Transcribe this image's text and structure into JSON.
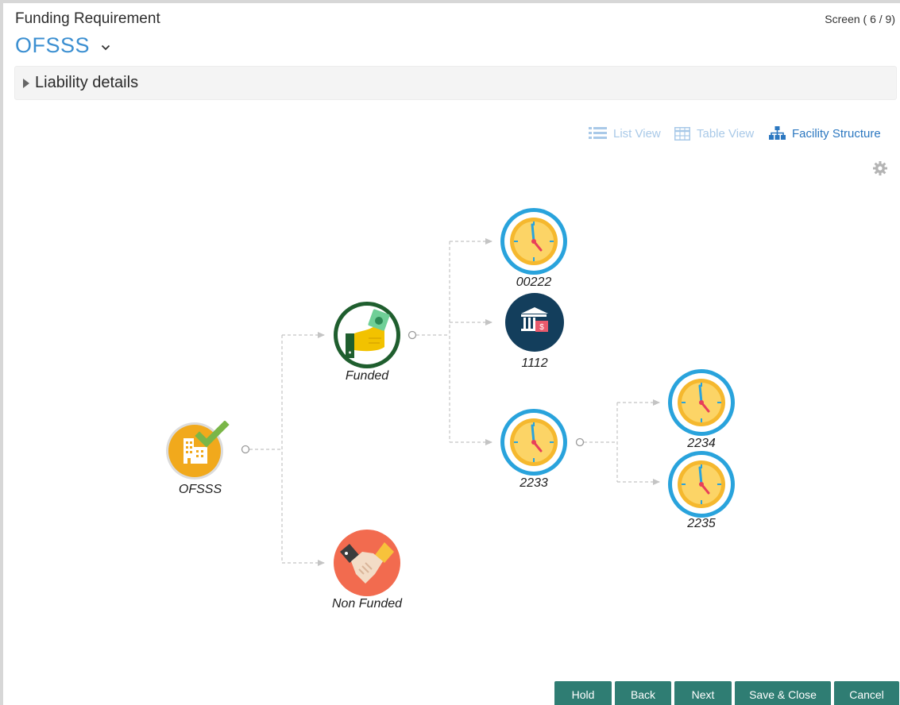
{
  "header": {
    "title": "Funding Requirement",
    "screen_indicator": "Screen ( 6 / 9)",
    "selected_app": "OFSSS"
  },
  "section": {
    "label": "Liability details"
  },
  "views": {
    "list_view": "List View",
    "table_view": "Table View",
    "facility_structure": "Facility Structure"
  },
  "tree": {
    "root": {
      "label": "OFSSS",
      "icon": "building-check-icon"
    },
    "funded": {
      "label": "Funded",
      "icon": "hand-money-icon"
    },
    "non_funded": {
      "label": "Non Funded",
      "icon": "handshake-icon"
    },
    "facility_00222": {
      "label": "00222",
      "icon": "clock-icon"
    },
    "facility_1112": {
      "label": "1112",
      "icon": "bank-icon"
    },
    "facility_2233": {
      "label": "2233",
      "icon": "clock-icon"
    },
    "facility_2234": {
      "label": "2234",
      "icon": "clock-icon"
    },
    "facility_2235": {
      "label": "2235",
      "icon": "clock-icon"
    }
  },
  "footer": {
    "hold": "Hold",
    "back": "Back",
    "next": "Next",
    "save_close": "Save & Close",
    "cancel": "Cancel"
  },
  "colors": {
    "accent": "#3b8fd1",
    "button": "#2f7d73",
    "clock_ring": "#29a3dc",
    "clock_face": "#f5b82e"
  }
}
